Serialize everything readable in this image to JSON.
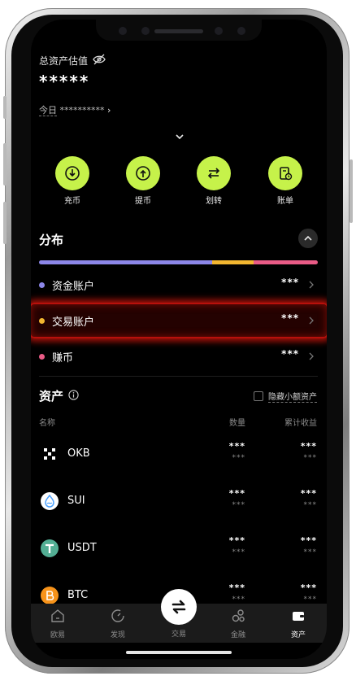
{
  "overview": {
    "total_label": "总资产估值",
    "total_masked": "*****",
    "today_label": "今日",
    "today_masked": "**********"
  },
  "actions": [
    {
      "label": "充币",
      "icon": "deposit-icon"
    },
    {
      "label": "提币",
      "icon": "withdraw-icon"
    },
    {
      "label": "划转",
      "icon": "transfer-icon"
    },
    {
      "label": "账单",
      "icon": "bill-icon"
    }
  ],
  "distribution": {
    "title": "分布",
    "segments": [
      {
        "account": "资金账户",
        "fraction": 0.62,
        "color": "#8c86e8"
      },
      {
        "account": "交易账户",
        "fraction": 0.15,
        "color": "#f2b630"
      },
      {
        "account": "赚币",
        "fraction": 0.23,
        "color": "#e95b86"
      }
    ],
    "accounts": [
      {
        "name": "资金账户",
        "value": "***",
        "color": "#8c86e8"
      },
      {
        "name": "交易账户",
        "value": "***",
        "color": "#f2b630"
      },
      {
        "name": "赚币",
        "value": "***",
        "color": "#e95b86"
      }
    ]
  },
  "assets": {
    "title": "资产",
    "hide_small_label": "隐藏小额资产",
    "columns": {
      "name": "名称",
      "qty": "数量",
      "pnl": "累计收益"
    },
    "rows": [
      {
        "symbol": "OKB",
        "icon": "okb-icon",
        "qty": "***",
        "qty_sub": "***",
        "pnl": "***",
        "pnl_sub": "***",
        "color": "#000000"
      },
      {
        "symbol": "SUI",
        "icon": "sui-icon",
        "qty": "***",
        "qty_sub": "***",
        "pnl": "***",
        "pnl_sub": "***",
        "color": "#ffffff"
      },
      {
        "symbol": "USDT",
        "icon": "usdt-icon",
        "qty": "***",
        "qty_sub": "***",
        "pnl": "***",
        "pnl_sub": "***",
        "color": "#53ae94"
      },
      {
        "symbol": "BTC",
        "icon": "btc-icon",
        "qty": "***",
        "qty_sub": "***",
        "pnl": "***",
        "pnl_sub": "***",
        "color": "#f7931a"
      }
    ]
  },
  "nav": {
    "tabs": [
      {
        "label": "欧易",
        "icon": "home-icon"
      },
      {
        "label": "发现",
        "icon": "discover-icon"
      },
      {
        "label": "交易",
        "icon": "trade-icon"
      },
      {
        "label": "金融",
        "icon": "finance-icon"
      },
      {
        "label": "资产",
        "icon": "wallet-icon"
      }
    ],
    "active": "资产"
  },
  "colors": {
    "accent": "#c6f24a",
    "highlight": "#b8100b"
  }
}
